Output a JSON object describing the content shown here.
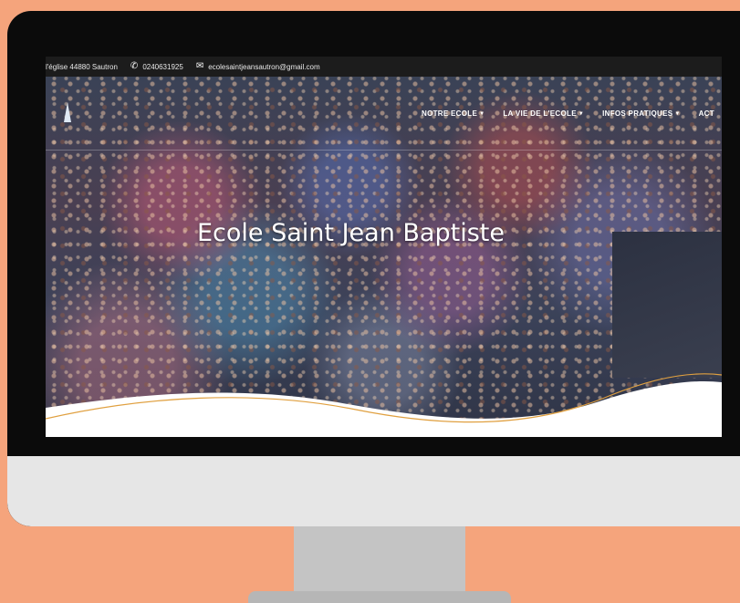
{
  "topbar": {
    "address": "l'église 44880 Sautron",
    "phone": "0240631925",
    "email": "ecolesaintjeansautron@gmail.com",
    "icons": {
      "phone": "phone-icon",
      "email": "envelope-icon"
    }
  },
  "nav": {
    "items": [
      {
        "label": "NOTRE ECOLE"
      },
      {
        "label": "LA VIE DE L'ECOLE"
      },
      {
        "label": "INFOS PRATIQUES"
      },
      {
        "label": "ACT"
      }
    ]
  },
  "hero": {
    "title": "Ecole Saint Jean Baptiste"
  },
  "colors": {
    "background": "#F5A47C",
    "monitor_bezel": "#0b0b0b",
    "monitor_chin": "#e6e6e6",
    "stand": "#c4c4c4",
    "wave_accent": "#E0A040",
    "topbar": "#1c1c1c"
  }
}
